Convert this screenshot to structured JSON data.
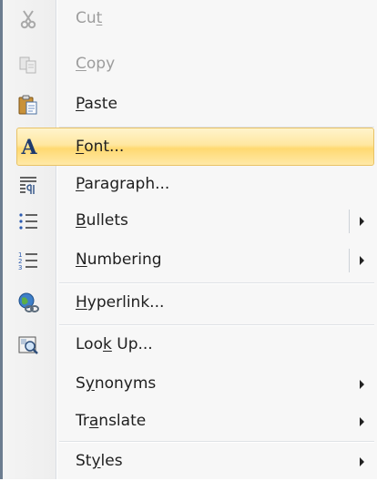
{
  "menu": {
    "items": [
      {
        "id": "cut",
        "label": "Cut",
        "accel_pre": "Cu",
        "accel_key": "t",
        "accel_post": "",
        "icon": "scissors-icon",
        "disabled": true
      },
      {
        "id": "copy",
        "label": "Copy",
        "accel_pre": "",
        "accel_key": "C",
        "accel_post": "opy",
        "icon": "copy-icon",
        "disabled": true
      },
      {
        "id": "paste",
        "label": "Paste",
        "accel_pre": "",
        "accel_key": "P",
        "accel_post": "aste",
        "icon": "paste-icon",
        "disabled": false
      },
      {
        "id": "font",
        "label": "Font...",
        "accel_pre": "",
        "accel_key": "F",
        "accel_post": "ont...",
        "icon": "font-icon",
        "highlighted": true
      },
      {
        "id": "paragraph",
        "label": "Paragraph...",
        "accel_pre": "",
        "accel_key": "P",
        "accel_post": "aragraph...",
        "icon": "paragraph-icon"
      },
      {
        "id": "bullets",
        "label": "Bullets",
        "accel_pre": "",
        "accel_key": "B",
        "accel_post": "ullets",
        "icon": "bullets-icon",
        "submenu": true,
        "split": true
      },
      {
        "id": "numbering",
        "label": "Numbering",
        "accel_pre": "",
        "accel_key": "N",
        "accel_post": "umbering",
        "icon": "numbering-icon",
        "submenu": true,
        "split": true
      },
      {
        "id": "hyperlink",
        "label": "Hyperlink...",
        "accel_pre": "",
        "accel_key": "H",
        "accel_post": "yperlink...",
        "icon": "hyperlink-icon"
      },
      {
        "id": "lookup",
        "label": "Look Up...",
        "accel_pre": "Loo",
        "accel_key": "k",
        "accel_post": " Up...",
        "icon": "research-icon"
      },
      {
        "id": "synonyms",
        "label": "Synonyms",
        "accel_pre": "S",
        "accel_key": "y",
        "accel_post": "nonyms",
        "icon": "",
        "submenu": true
      },
      {
        "id": "translate",
        "label": "Translate",
        "accel_pre": "Tr",
        "accel_key": "a",
        "accel_post": "nslate",
        "icon": "",
        "submenu": true
      },
      {
        "id": "styles",
        "label": "Styles",
        "accel_pre": "St",
        "accel_key": "y",
        "accel_post": "les",
        "icon": "",
        "submenu": true
      }
    ]
  },
  "colors": {
    "highlight_top": "#fff4cc",
    "highlight_mid": "#ffd971",
    "highlight_border": "#e8c266",
    "disabled_text": "#9d9d9d",
    "text": "#202020"
  }
}
